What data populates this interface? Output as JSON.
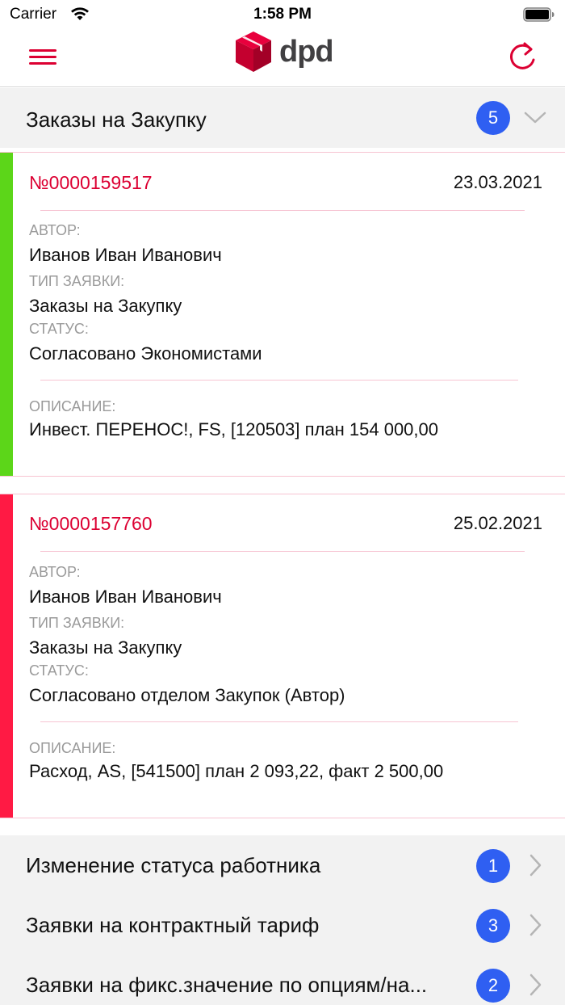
{
  "status_bar": {
    "carrier": "Carrier",
    "time": "1:58 PM"
  },
  "nav": {
    "logo_text": "dpd",
    "brand_color": "#dc0032"
  },
  "section": {
    "title": "Заказы на Закупку",
    "count": "5"
  },
  "cards": [
    {
      "number": "№0000159517",
      "date": "23.03.2021",
      "status_color": "#5cd619",
      "author_label": "АВТОР:",
      "author": "Иванов Иван Иванович",
      "type_label": "ТИП ЗАЯВКИ:",
      "type": "Заказы на Закупку",
      "status_label": "СТАТУС:",
      "status": "Согласовано Экономистами",
      "desc_label": "ОПИСАНИЕ:",
      "desc": "Инвест. ПЕРЕНОС!, FS, [120503] план 154 000,00"
    },
    {
      "number": "№0000157760",
      "date": "25.02.2021",
      "status_color": "#ff1a44",
      "author_label": "АВТОР:",
      "author": "Иванов Иван Иванович",
      "type_label": "ТИП ЗАЯВКИ:",
      "type": "Заказы на Закупку",
      "status_label": "СТАТУС:",
      "status": "Согласовано отделом Закупок (Автор)",
      "desc_label": "ОПИСАНИЕ:",
      "desc": "Расход, AS, [541500] план 2 093,22, факт 2 500,00"
    }
  ],
  "categories": [
    {
      "label": "Изменение статуса работника",
      "count": "1"
    },
    {
      "label": "Заявки на контрактный тариф",
      "count": "3"
    },
    {
      "label": "Заявки на фикс.значение по опциям/на...",
      "count": "2"
    }
  ]
}
